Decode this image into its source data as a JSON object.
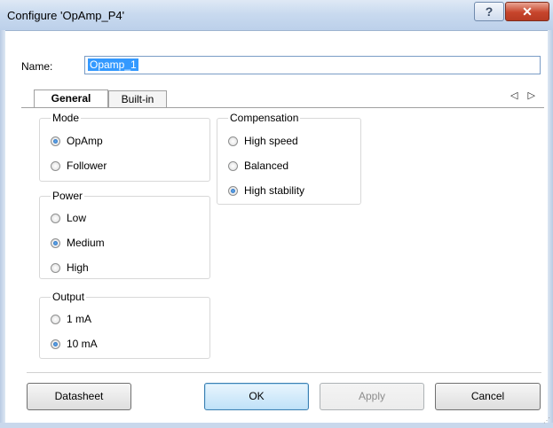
{
  "window": {
    "title": "Configure 'OpAmp_P4'",
    "help_label": "?",
    "close_label": "✕"
  },
  "name": {
    "label": "Name:",
    "value": "Opamp_1"
  },
  "tabs": [
    {
      "label": "General",
      "active": true
    },
    {
      "label": "Built-in",
      "active": false
    }
  ],
  "tab_scroll_label": "◁ ▷",
  "groups": {
    "mode": {
      "title": "Mode",
      "options": [
        {
          "label": "OpAmp",
          "selected": true
        },
        {
          "label": "Follower",
          "selected": false
        }
      ]
    },
    "power": {
      "title": "Power",
      "options": [
        {
          "label": "Low",
          "selected": false
        },
        {
          "label": "Medium",
          "selected": true
        },
        {
          "label": "High",
          "selected": false
        }
      ]
    },
    "output": {
      "title": "Output",
      "options": [
        {
          "label": "1 mA",
          "selected": false
        },
        {
          "label": "10 mA",
          "selected": true
        }
      ]
    },
    "compensation": {
      "title": "Compensation",
      "options": [
        {
          "label": "High speed",
          "selected": false
        },
        {
          "label": "Balanced",
          "selected": false
        },
        {
          "label": "High stability",
          "selected": true
        }
      ]
    }
  },
  "buttons": {
    "datasheet": "Datasheet",
    "ok": "OK",
    "apply": "Apply",
    "cancel": "Cancel"
  },
  "colors": {
    "selection": "#3399ff",
    "radio_dot": "#1b5fb0",
    "close_button": "#c7452c"
  }
}
